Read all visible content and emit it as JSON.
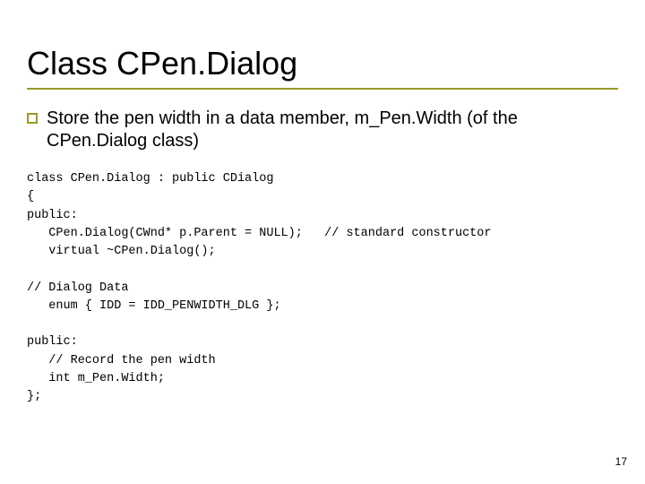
{
  "title": "Class CPen.Dialog",
  "bullet": "Store the pen width in a data member, m_Pen.Width (of the CPen.Dialog class)",
  "code": "class CPen.Dialog : public CDialog\n{\npublic:\n   CPen.Dialog(CWnd* p.Parent = NULL);   // standard constructor\n   virtual ~CPen.Dialog();\n\n// Dialog Data\n   enum { IDD = IDD_PENWIDTH_DLG };\n\npublic:\n   // Record the pen width\n   int m_Pen.Width;\n};",
  "page_number": "17"
}
